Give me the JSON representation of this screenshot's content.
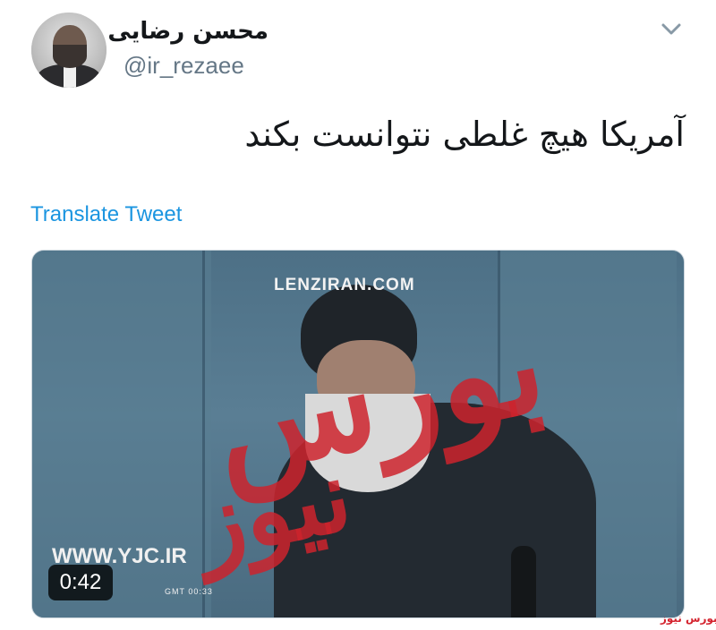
{
  "tweet": {
    "author": {
      "display_name": "محسن رضایی",
      "handle": "@ir_rezaee"
    },
    "text": "آمریکا هیچ غلطی نتوانست بکند",
    "translate_label": "Translate Tweet",
    "media": {
      "duration": "0:42",
      "overlay_texts": {
        "top": "LENZIRAN.COM",
        "bottom_left": "WWW.YJC.IR",
        "gmt": "GMT 00:33"
      },
      "watermark_line1": "بورس",
      "watermark_line2": "نیوز"
    }
  },
  "footer_watermark": "بورس نیوز",
  "colors": {
    "link": "#1b95e0",
    "secondary_text": "#657786",
    "watermark": "#cd232d"
  }
}
